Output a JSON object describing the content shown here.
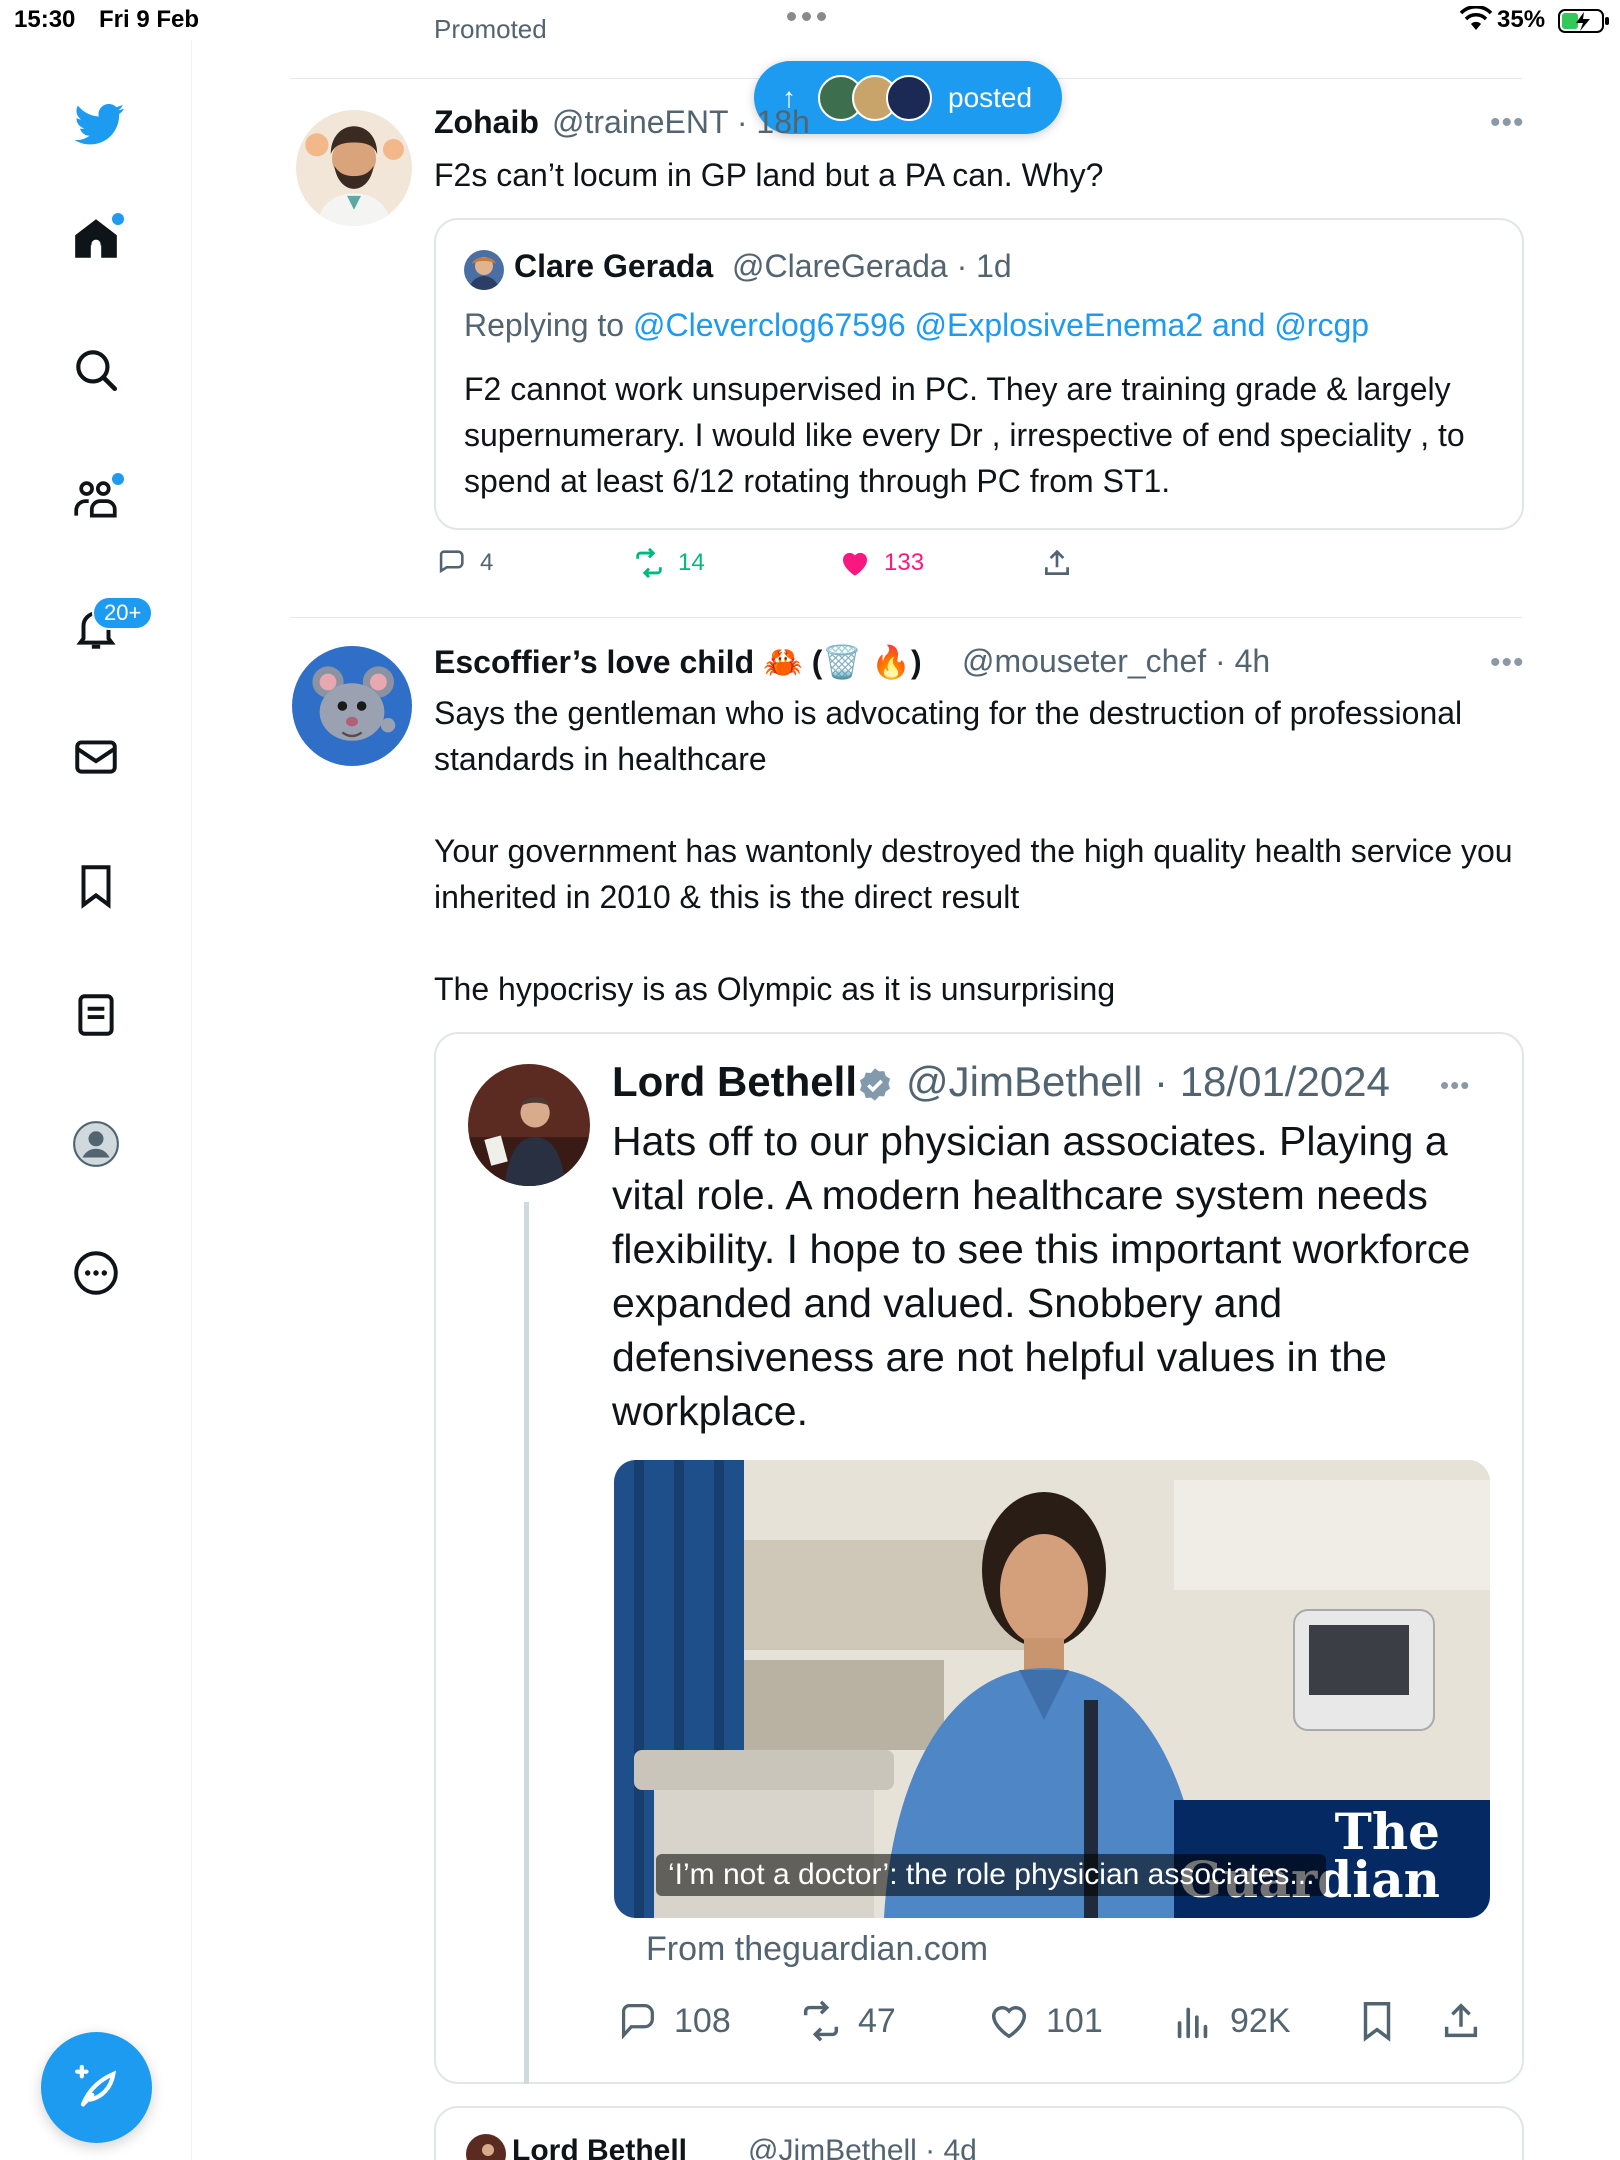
{
  "status_bar": {
    "time": "15:30",
    "date": "Fri 9 Feb",
    "battery": "35%"
  },
  "sidebar": {
    "notification_count": "20+",
    "items": [
      "home",
      "explore",
      "communities",
      "notifications",
      "messages",
      "bookmarks",
      "lists",
      "profile",
      "more"
    ]
  },
  "new_posts_pill": {
    "label": "posted"
  },
  "promoted_stub": "Promoted",
  "tweet1": {
    "name": "Zohaib",
    "handle": "@traineENT · 18h",
    "text": "F2s can’t locum in GP land but a PA can. Why?",
    "quote": {
      "name": "Clare Gerada",
      "handle": "@ClareGerada · 1d",
      "replying_prefix": "Replying to ",
      "replying_to": "@Cleverclog67596 @ExplosiveEnema2 and @rcgp",
      "text": "F2 cannot work unsupervised in PC. They are training grade & largely supernumerary. I would  like every Dr , irrespective of end speciality , to spend at least 6/12 rotating through PC from ST1."
    },
    "replies": "4",
    "reposts": "14",
    "likes": "133"
  },
  "tweet2": {
    "name": "Escoffier’s love child 🦀 (🗑️ 🔥)",
    "handle": "@mouseter_chef · 4h",
    "text_p1": "Says the gentleman who is advocating for the destruction of professional standards in healthcare",
    "text_p2": "Your government has wantonly destroyed the high quality health service you inherited in 2010 & this is the direct result",
    "text_p3": "The hypocrisy is as Olympic as it is unsurprising",
    "quote": {
      "name": "Lord Bethell",
      "handle": "@JimBethell · 18/01/2024",
      "text": "Hats off to our physician associates. Playing a vital role. A modern healthcare system needs flexibility. I hope to see this important workforce expanded and valued. Snobbery and defensiveness are not helpful values in the workplace.",
      "media_caption": "‘I’m not a doctor’: the role physician associates...",
      "media_logo_line1": "The",
      "media_logo_line2": "Guardian",
      "from": "From theguardian.com",
      "replies": "108",
      "reposts": "47",
      "likes": "101",
      "views": "92K"
    }
  },
  "tweet3": {
    "name": "Lord Bethell",
    "handle": "@JimBethell · 4d"
  },
  "colors": {
    "accent": "#1d9bf0",
    "like": "#f91880",
    "repost": "#00ba7c",
    "muted": "#536471"
  }
}
